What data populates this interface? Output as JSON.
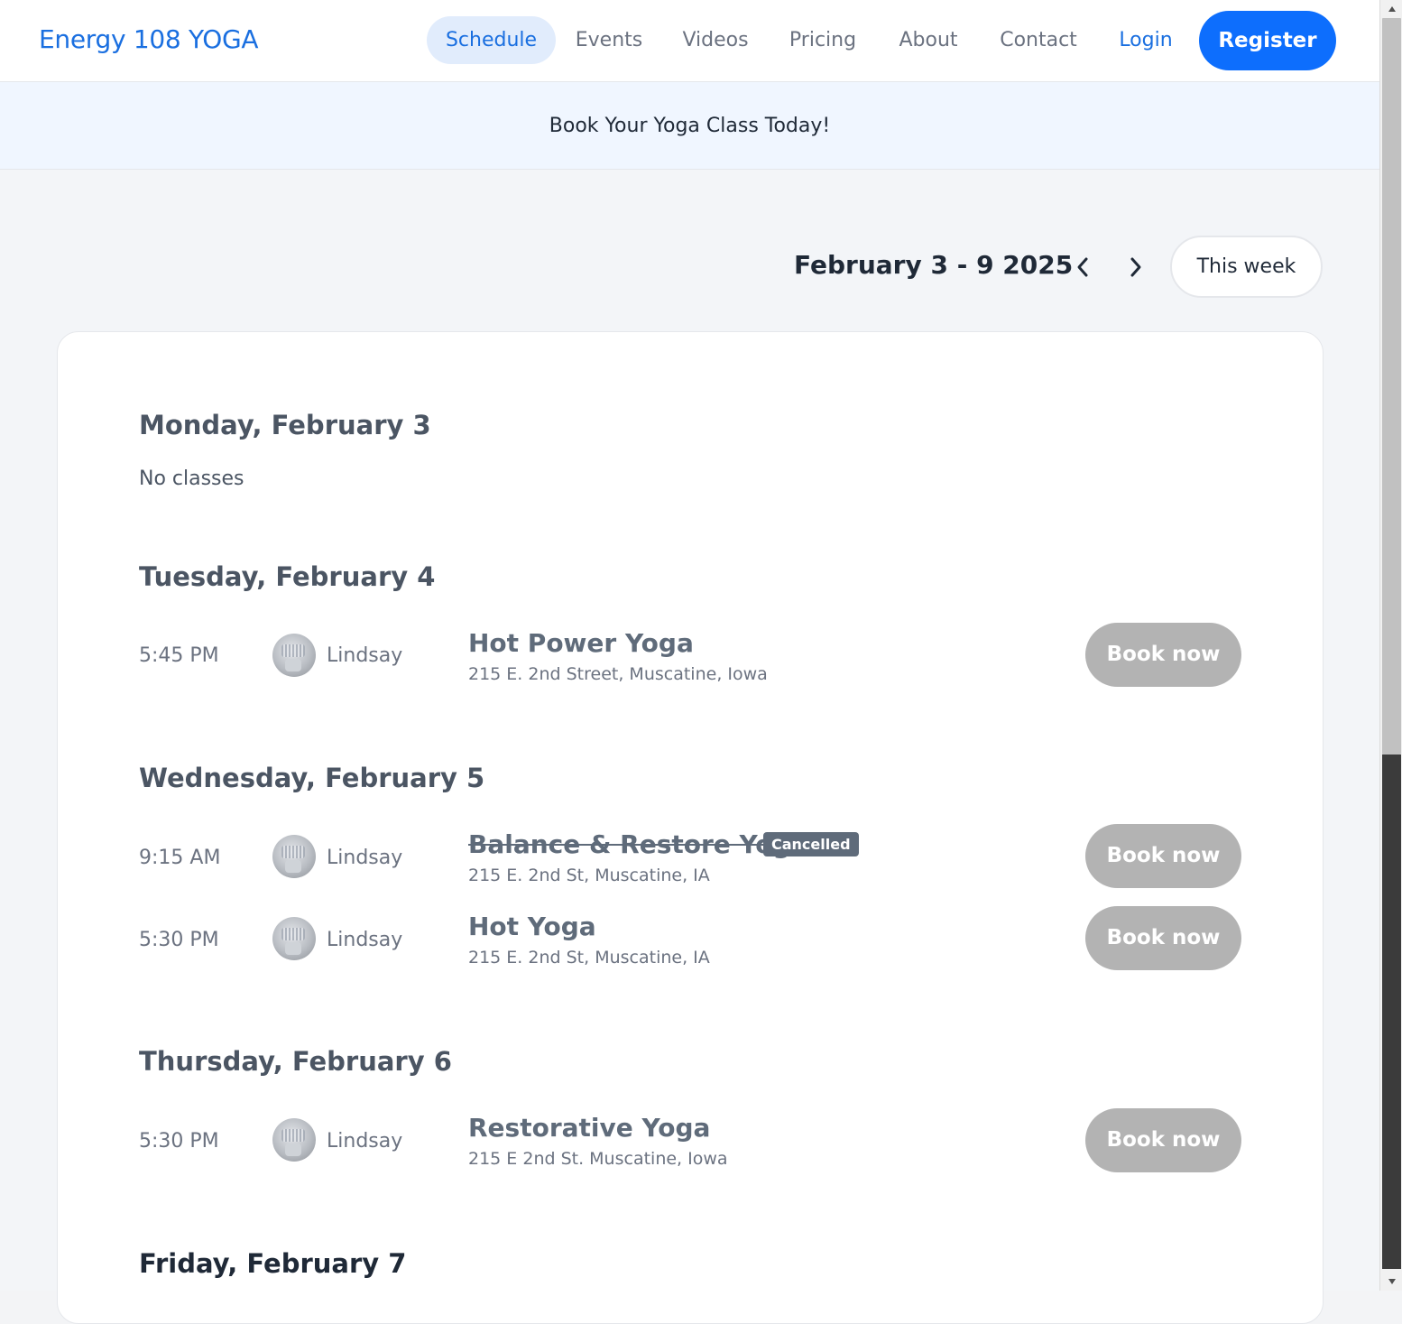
{
  "header": {
    "brand": "Energy 108 YOGA",
    "nav": {
      "schedule": "Schedule",
      "events": "Events",
      "videos": "Videos",
      "pricing": "Pricing",
      "about": "About",
      "contact": "Contact",
      "login": "Login"
    },
    "register": "Register"
  },
  "banner": {
    "text": "Book Your Yoga Class Today!"
  },
  "week": {
    "range": "February 3 - 9 2025",
    "prev_icon": "chevron-left-icon",
    "next_icon": "chevron-right-icon",
    "this_week": "This week"
  },
  "schedule": {
    "days": [
      {
        "heading": "Monday, February 3",
        "empty_text": "No classes"
      },
      {
        "heading": "Tuesday, February 4"
      },
      {
        "heading": "Wednesday, February 5"
      },
      {
        "heading": "Thursday, February 6"
      },
      {
        "heading": "Friday, February 7"
      }
    ],
    "classes": [
      {
        "time": "5:45 PM",
        "instructor": "Lindsay",
        "name": "Hot Power Yoga",
        "address": "215 E. 2nd Street, Muscatine, Iowa",
        "book": "Book now"
      },
      {
        "time": "9:15 AM",
        "instructor": "Lindsay",
        "name": "Balance & Restore Yoga",
        "badge": "Cancelled",
        "address": "215 E. 2nd St, Muscatine, IA",
        "book": "Book now"
      },
      {
        "time": "5:30 PM",
        "instructor": "Lindsay",
        "name": "Hot Yoga",
        "address": "215 E. 2nd St, Muscatine, IA",
        "book": "Book now"
      },
      {
        "time": "5:30 PM",
        "instructor": "Lindsay",
        "name": "Restorative Yoga",
        "address": "215 E 2nd St. Muscatine, Iowa",
        "book": "Book now"
      }
    ]
  },
  "colors": {
    "brand": "#1a6fe0",
    "register_bg": "#0d6efd",
    "book_disabled": "#b3b3b3",
    "cancelled_badge": "#5f6b7a"
  }
}
